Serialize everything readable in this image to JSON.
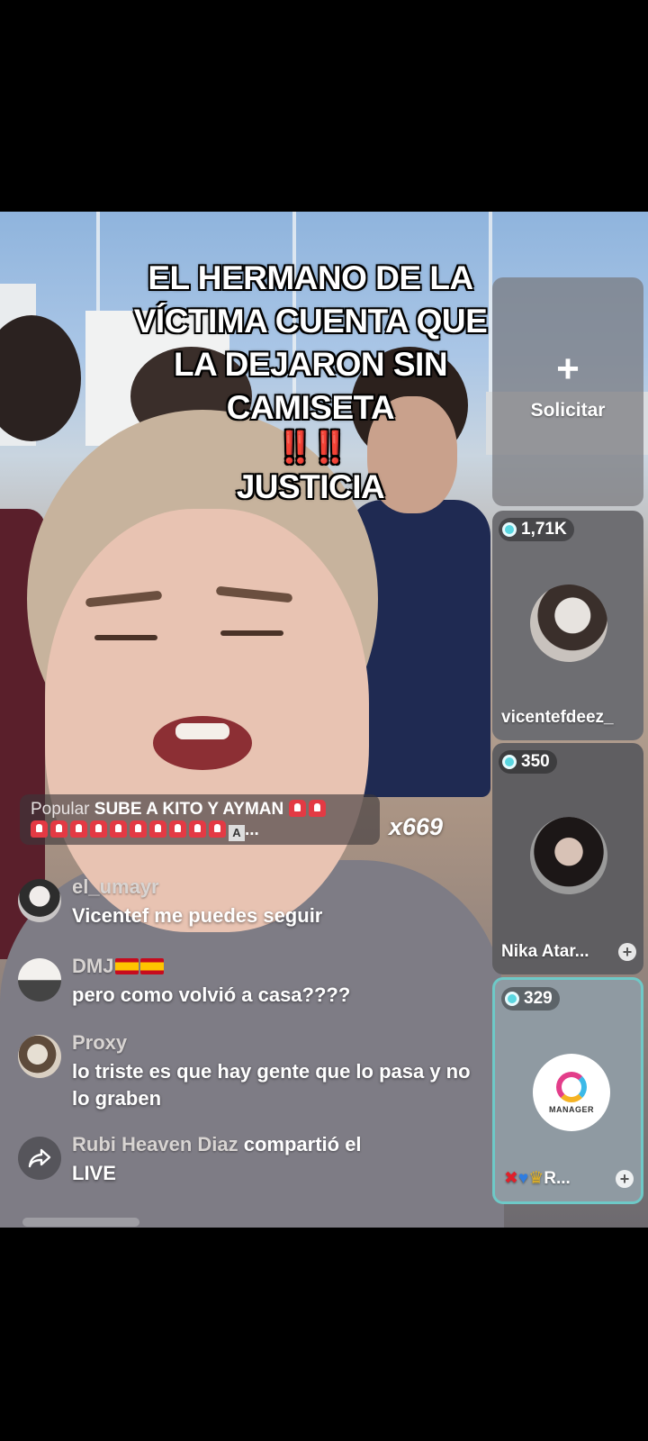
{
  "caption": {
    "lines": [
      "EL HERMANO DE LA",
      "VÍCTIMA CUENTA QUE",
      "LA DEJARON SIN",
      "CAMISETA"
    ],
    "bangs": "‼️‼️",
    "last_line": "JUSTICIA"
  },
  "request_panel": {
    "plus": "+",
    "label": "Solicitar"
  },
  "guests": [
    {
      "viewers": "1,71K",
      "name": "vicentefdeez_"
    },
    {
      "viewers": "350",
      "name": "Nika Atar...",
      "add": "+"
    },
    {
      "viewers": "329",
      "name": "R...",
      "add": "+",
      "logo_text": "MANAGER"
    }
  ],
  "popular": {
    "tag": "Popular",
    "text": "SUBE A KITO Y AYMAN",
    "ellipsis": "..."
  },
  "combo": "x669",
  "comments": [
    {
      "user": "el_umayr",
      "text": "Vicentef me puedes seguir"
    },
    {
      "user": "DMJ",
      "text": "pero como volvió a casa????"
    },
    {
      "user": "Proxy",
      "text": "lo triste es que hay gente que lo pasa y no lo graben"
    },
    {
      "user": "Rubi Heaven Diaz",
      "action": "compartió el",
      "text": "LIVE"
    }
  ],
  "colors": {
    "accent_teal": "#6ec9c7",
    "alert_red": "#e8101a"
  }
}
